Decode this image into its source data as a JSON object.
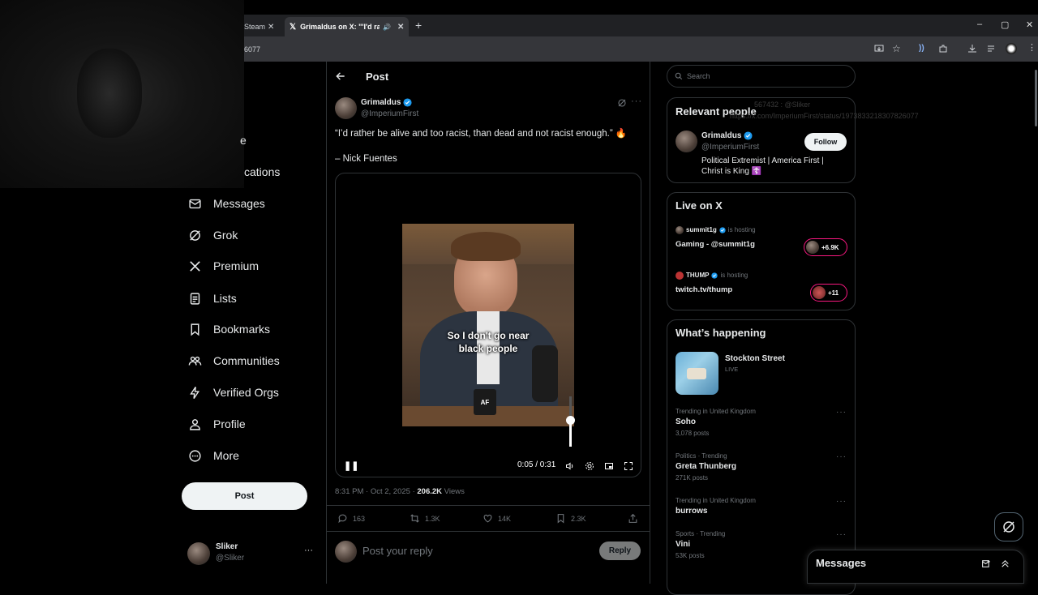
{
  "browser": {
    "tabs": [
      {
        "label": "Steam",
        "active": false
      },
      {
        "label": "Grimaldus on X: \"'I'd rathe",
        "active": true
      }
    ],
    "address_fragment": "6077",
    "window_controls": [
      "–",
      "▢",
      "✕"
    ]
  },
  "overlay": {
    "line1": "567432 : @Sliker",
    "line2": "https://x.com/ImperiumFirst/status/1973833218307826077"
  },
  "sidebar": {
    "items": [
      {
        "label": "e",
        "icon": "home-icon"
      },
      {
        "label": "cations",
        "icon": "bell-icon"
      },
      {
        "label": "Messages",
        "icon": "envelope-icon"
      },
      {
        "label": "Grok",
        "icon": "grok-icon"
      },
      {
        "label": "Premium",
        "icon": "x-logo-icon"
      },
      {
        "label": "Lists",
        "icon": "list-icon"
      },
      {
        "label": "Bookmarks",
        "icon": "bookmark-icon"
      },
      {
        "label": "Communities",
        "icon": "communities-icon"
      },
      {
        "label": "Verified Orgs",
        "icon": "lightning-icon"
      },
      {
        "label": "Profile",
        "icon": "person-icon"
      },
      {
        "label": "More",
        "icon": "more-circle-icon"
      }
    ],
    "post_label": "Post",
    "account": {
      "name": "Sliker",
      "handle": "@Sliker",
      "menu": "···"
    }
  },
  "main": {
    "header_title": "Post",
    "author": {
      "name": "Grimaldus",
      "handle": "@ImperiumFirst"
    },
    "tweet_text": "“I’d rather be alive and too racist, than dead and not racist enough.” 🔥",
    "tweet_attribution": "– Nick Fuentes",
    "video": {
      "caption_line1": "So I don't go near",
      "caption_line2": "black people",
      "mug_logo": "AF",
      "time": "0:05 / 0:31",
      "progress": 0.16
    },
    "timestamp": "8:31 PM · Oct 2, 2025 · ",
    "views_count": "206.2K",
    "views_label": " Views",
    "actions": {
      "replies": "163",
      "reposts": "1.3K",
      "likes": "14K",
      "bookmarks": "2.3K"
    },
    "reply_placeholder": "Post your reply",
    "reply_button": "Reply"
  },
  "right": {
    "search_placeholder": "Search",
    "relevant": {
      "title": "Relevant people",
      "name": "Grimaldus",
      "handle": "@ImperiumFirst",
      "bio1": "Political Extremist | America First |",
      "bio2": "Christ is King ☦️",
      "follow": "Follow"
    },
    "live": {
      "title": "Live on X",
      "items": [
        {
          "host": "summit1g",
          "status": "is hosting",
          "title": "Gaming - @summit1g",
          "count": "+6.9K"
        },
        {
          "host": "THUMP",
          "status": "is hosting",
          "title": "twitch.tv/thump",
          "count": "+11"
        }
      ]
    },
    "happening": {
      "title": "What’s happening",
      "featured": {
        "title": "Stockton Street",
        "status": "LIVE"
      },
      "trends": [
        {
          "context": "Trending in United Kingdom",
          "name": "Soho",
          "posts": "3,078 posts"
        },
        {
          "context": "Politics · Trending",
          "name": "Greta Thunberg",
          "posts": "271K posts"
        },
        {
          "context": "Trending in United Kingdom",
          "name": "burrows",
          "posts": ""
        },
        {
          "context": "Sports · Trending",
          "name": "Vini",
          "posts": "53K posts"
        }
      ]
    },
    "messages_title": "Messages"
  },
  "colors": {
    "accent": "#1d9bf0",
    "live_pink": "#f91880",
    "bg": "#000000",
    "border": "#2f3336"
  }
}
